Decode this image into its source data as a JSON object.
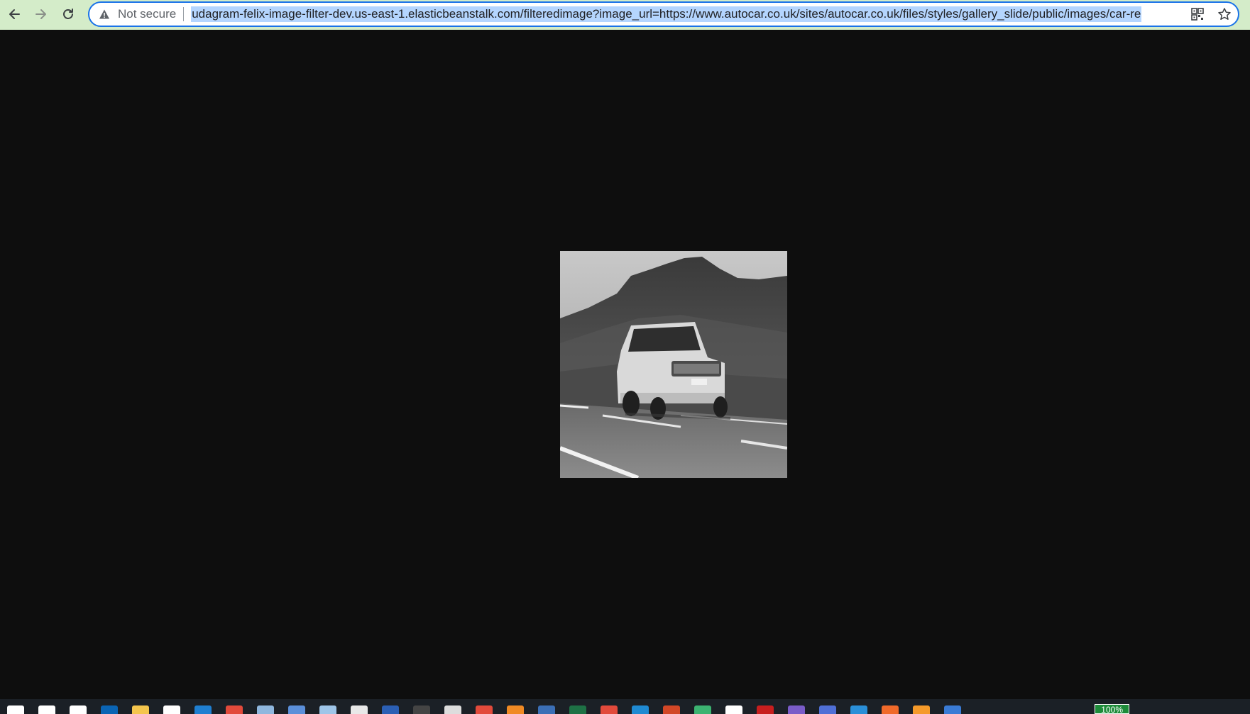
{
  "browser": {
    "security_label": "Not secure",
    "url": "udagram-felix-image-filter-dev.us-east-1.elasticbeanstalk.com/filteredimage?image_url=https://www.autocar.co.uk/sites/autocar.co.uk/files/styles/gallery_slide/public/images/car-re",
    "icons": {
      "back": "arrow-left-icon",
      "forward": "arrow-right-icon",
      "reload": "reload-icon",
      "warning": "warning-triangle-icon",
      "qr": "qr-code-icon",
      "bookmark": "star-icon"
    },
    "colors": {
      "toolbar_bg": "#d4ecc9",
      "omnibox_border": "#1a73e8",
      "url_selection": "#b4d5fe",
      "page_bg": "#0e0e0e"
    }
  },
  "page": {
    "image": {
      "subject": "grayscale-filtered photo of an SUV on a mountain road",
      "filter": "grayscale"
    }
  },
  "taskbar": {
    "battery_label": "100%",
    "apps": [
      {
        "icon": "windows-start-icon",
        "color": "#ffffff"
      },
      {
        "icon": "search-icon",
        "color": "#ffffff"
      },
      {
        "icon": "task-view-icon",
        "color": "#ffffff"
      },
      {
        "icon": "mail-icon",
        "color": "#0a64b4"
      },
      {
        "icon": "folder-icon",
        "color": "#f4c54d"
      },
      {
        "icon": "store-icon",
        "color": "#ffffff"
      },
      {
        "icon": "edge-icon",
        "color": "#1f7fd1"
      },
      {
        "icon": "chrome-icon",
        "color": "#e24a3b"
      },
      {
        "icon": "box-icon",
        "color": "#8fb7de"
      },
      {
        "icon": "app-icon",
        "color": "#5b8fd9"
      },
      {
        "icon": "app-icon",
        "color": "#9ec5e8"
      },
      {
        "icon": "envelope-icon",
        "color": "#e8e8e8"
      },
      {
        "icon": "word-icon",
        "color": "#2b5fb4"
      },
      {
        "icon": "terminal-icon",
        "color": "#444444"
      },
      {
        "icon": "notepad-icon",
        "color": "#dddddd"
      },
      {
        "icon": "chrome-icon",
        "color": "#e24a3b"
      },
      {
        "icon": "app-icon",
        "color": "#f08a24"
      },
      {
        "icon": "app-icon",
        "color": "#3b6fb6"
      },
      {
        "icon": "excel-icon",
        "color": "#1e7145"
      },
      {
        "icon": "chrome-icon",
        "color": "#e24a3b"
      },
      {
        "icon": "vscode-icon",
        "color": "#1f8ad2"
      },
      {
        "icon": "powerpoint-icon",
        "color": "#d24726"
      },
      {
        "icon": "app-icon",
        "color": "#3cb371"
      },
      {
        "icon": "settings-icon",
        "color": "#ffffff"
      },
      {
        "icon": "app-icon",
        "color": "#c81e1e"
      },
      {
        "icon": "app-icon",
        "color": "#7a5cc8"
      },
      {
        "icon": "app-icon",
        "color": "#4f6fd6"
      },
      {
        "icon": "app-icon",
        "color": "#2a8fd8"
      },
      {
        "icon": "app-icon",
        "color": "#f06a2a"
      },
      {
        "icon": "firefox-icon",
        "color": "#f59a2a"
      },
      {
        "icon": "app-icon",
        "color": "#3a7bd5"
      }
    ]
  }
}
